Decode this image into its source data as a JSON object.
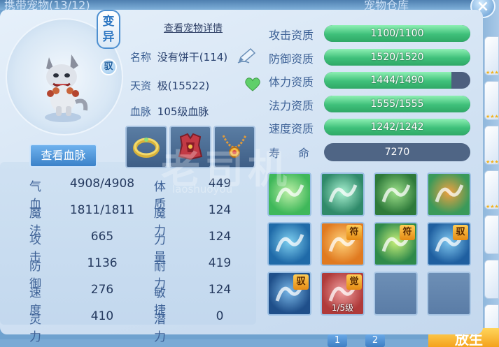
{
  "window": {
    "left_title": "携带宠物(13/12)",
    "right_title": "宠物仓库",
    "close_label": "×"
  },
  "pet": {
    "variant_badge": "变异",
    "yu_badge": "驭",
    "detail_link": "查看宠物详情",
    "name_label": "名称",
    "name_value": "没有饼干(114)",
    "talent_label": "天资",
    "talent_value": "极(15522)",
    "blood_label": "血脉",
    "blood_value": "105级血脉",
    "view_blood_button": "查看血脉"
  },
  "equipment": [
    {
      "name": "ring-icon"
    },
    {
      "name": "armor-icon"
    },
    {
      "name": "necklace-icon"
    }
  ],
  "stats": [
    {
      "key": "气血",
      "value": "4908/4908"
    },
    {
      "key": "体质",
      "value": "449"
    },
    {
      "key": "魔法",
      "value": "1811/1811"
    },
    {
      "key": "魔力",
      "value": "124"
    },
    {
      "key": "攻击",
      "value": "665"
    },
    {
      "key": "力量",
      "value": "124"
    },
    {
      "key": "防御",
      "value": "1136"
    },
    {
      "key": "耐力",
      "value": "419"
    },
    {
      "key": "速度",
      "value": "276"
    },
    {
      "key": "敏捷",
      "value": "124"
    },
    {
      "key": "灵力",
      "value": "410"
    },
    {
      "key": "潜力",
      "value": "0"
    }
  ],
  "aptitudes": [
    {
      "label": "攻击资质",
      "text": "1100/1100",
      "fraction": 1.0
    },
    {
      "label": "防御资质",
      "text": "1520/1520",
      "fraction": 1.0
    },
    {
      "label": "体力资质",
      "text": "1444/1490",
      "fraction": 0.87
    },
    {
      "label": "法力资质",
      "text": "1555/1555",
      "fraction": 1.0
    },
    {
      "label": "速度资质",
      "text": "1242/1242",
      "fraction": 1.0
    }
  ],
  "lifespan": {
    "label": "寿命",
    "value": "7270"
  },
  "skills": [
    {
      "name": "healing-heart-skill-icon",
      "tag": "",
      "level": ""
    },
    {
      "name": "wind-spirit-skill-icon",
      "tag": "",
      "level": ""
    },
    {
      "name": "leaping-beast-skill-icon",
      "tag": "",
      "level": ""
    },
    {
      "name": "elemental-orb-skill-icon",
      "tag": "",
      "level": ""
    },
    {
      "name": "water-wave-skill-icon",
      "tag": "",
      "level": ""
    },
    {
      "name": "shield-rune-skill-icon",
      "tag": "符",
      "level": ""
    },
    {
      "name": "glowing-figure-skill-icon",
      "tag": "符",
      "level": ""
    },
    {
      "name": "water-beast-skill-icon",
      "tag": "驭",
      "level": ""
    },
    {
      "name": "ice-golem-skill-icon",
      "tag": "驭",
      "level": ""
    },
    {
      "name": "awakened-warrior-skill-icon",
      "tag": "觉",
      "level": "1/5级"
    },
    {
      "name": "empty-skill-slot",
      "tag": "",
      "level": ""
    },
    {
      "name": "empty-skill-slot",
      "tag": "",
      "level": ""
    }
  ],
  "watermark": {
    "main": "老司机",
    "sub": "laoshuoyou"
  },
  "pager": {
    "page1": "1",
    "page2": "2"
  },
  "release_button": "放生",
  "colors": {
    "accent_blue": "#3b82c9",
    "bar_green": "#3fc07a",
    "bar_track": "#4d5f7e",
    "rune_tag": "#e58a14"
  }
}
